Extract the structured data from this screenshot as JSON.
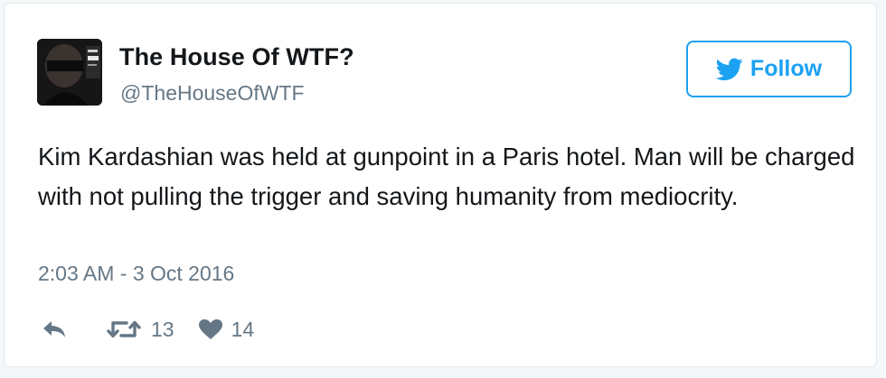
{
  "user": {
    "display_name": "The House Of WTF?",
    "handle": "@TheHouseOfWTF",
    "avatar_icon": "masked-figure-avatar"
  },
  "follow_button": {
    "label": "Follow",
    "icon": "twitter-bird-icon",
    "color": "#1da1f2"
  },
  "tweet": {
    "text": "Kim Kardashian was held at gunpoint in a Paris hotel. Man will be charged with not pulling the trigger and saving humanity from mediocrity.",
    "timestamp": "2:03 AM - 3 Oct 2016"
  },
  "actions": {
    "reply_icon": "reply-icon",
    "retweet_icon": "retweet-icon",
    "retweet_count": "13",
    "like_icon": "heart-icon",
    "like_count": "14"
  },
  "colors": {
    "text_primary": "#14171a",
    "text_secondary": "#657786",
    "accent": "#1da1f2",
    "border": "#e1e8ed"
  }
}
